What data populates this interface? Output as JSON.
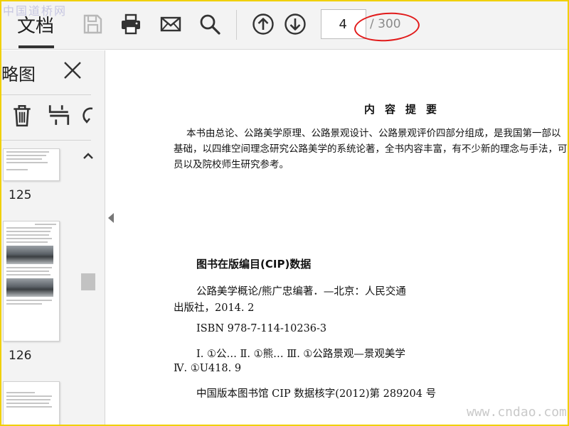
{
  "toolbar": {
    "doc_tab_label": "文档",
    "page_current": "4",
    "page_total": "/ 300",
    "icons": [
      "save-icon",
      "print-icon",
      "mail-icon",
      "search-icon",
      "arrow-up-icon",
      "arrow-down-icon"
    ]
  },
  "watermarks": {
    "top": "中国道桥网",
    "bottom": "www.cndao.com"
  },
  "sidebar": {
    "title": "略图",
    "thumbnails": [
      {
        "label": "125"
      },
      {
        "label": "126"
      }
    ]
  },
  "document": {
    "summary_title": "内容提要",
    "summary_lines": [
      "本书由总论、公路美学原理、公路景观设计、公路景观评价四部分组成，是我国第一部以",
      "基础，以四维空间理念研究公路美学的系统论著，全书内容丰富，有不少新的理念与手法，可",
      "员以及院校师生研究参考。"
    ],
    "cip_heading": "图书在版编目(CIP)数据",
    "cip_lines": [
      "公路美学概论/熊广忠编著．—北京：人民交通",
      "出版社，2014. 2",
      "ISBN 978-7-114-10236-3",
      "Ⅰ. ①公…    Ⅱ. ①熊…    Ⅲ. ①公路景观—景观美学",
      "Ⅳ. ①U418. 9",
      "中国版本图书馆 CIP 数据核字(2012)第 289204 号"
    ]
  },
  "colors": {
    "frame_border": "#f0d000",
    "annotation": "#e11a1a",
    "toolbar_bg": "#f3f3f3"
  }
}
